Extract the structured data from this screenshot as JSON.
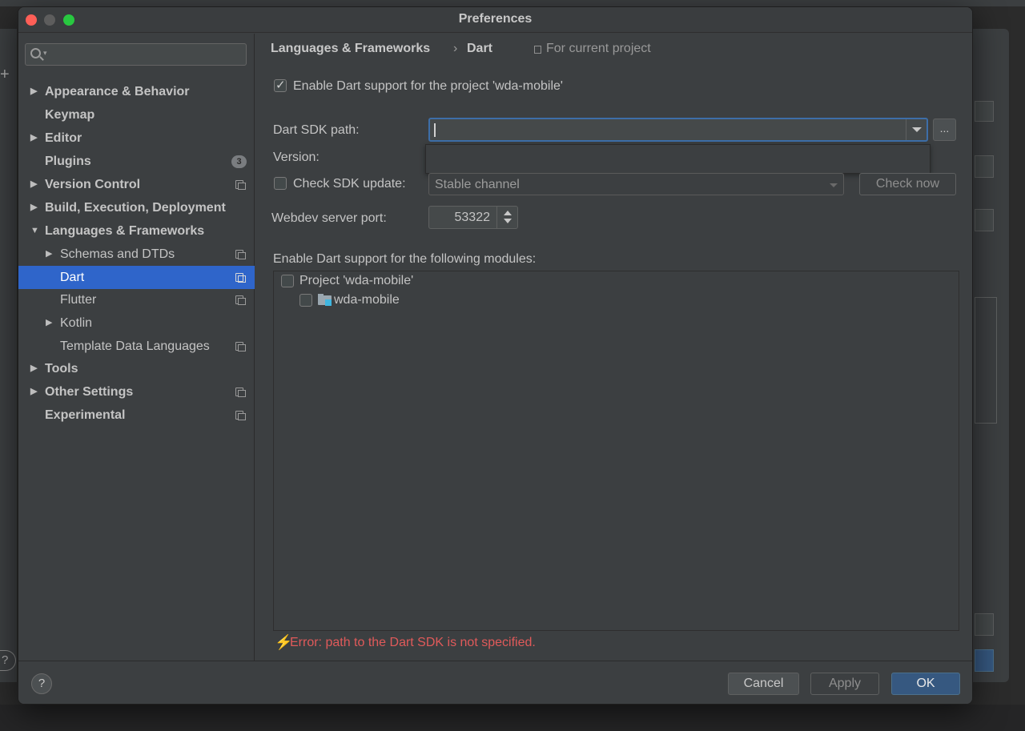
{
  "window": {
    "title": "Preferences"
  },
  "search": {
    "placeholder": ""
  },
  "sidebar": {
    "items": [
      {
        "label": "Appearance & Behavior",
        "arrow": "▶"
      },
      {
        "label": "Keymap"
      },
      {
        "label": "Editor",
        "arrow": "▶"
      },
      {
        "label": "Plugins",
        "badge": "3"
      },
      {
        "label": "Version Control",
        "arrow": "▶"
      },
      {
        "label": "Build, Execution, Deployment",
        "arrow": "▶"
      },
      {
        "label": "Languages & Frameworks",
        "arrow": "▼"
      },
      {
        "label": "Schemas and DTDs",
        "arrow": "▶"
      },
      {
        "label": "Dart"
      },
      {
        "label": "Flutter"
      },
      {
        "label": "Kotlin",
        "arrow": "▶"
      },
      {
        "label": "Template Data Languages"
      },
      {
        "label": "Tools",
        "arrow": "▶"
      },
      {
        "label": "Other Settings",
        "arrow": "▶"
      },
      {
        "label": "Experimental"
      }
    ]
  },
  "breadcrumb": {
    "parent": "Languages & Frameworks",
    "separator": "›",
    "current": "Dart",
    "scope": "For current project"
  },
  "dart": {
    "enable_label": "Enable Dart support for the project 'wda-mobile'",
    "enable_checked": true,
    "sdk_path_label": "Dart SDK path:",
    "sdk_path_value": "",
    "browse_label": "...",
    "version_label": "Version:",
    "check_update_label": "Check SDK update:",
    "check_update_checked": false,
    "channel_value": "Stable channel",
    "check_now_label": "Check now",
    "webdev_label": "Webdev server port:",
    "webdev_port": "53322",
    "modules_label": "Enable Dart support for the following modules:",
    "modules": [
      {
        "label": "Project 'wda-mobile'",
        "checked": false
      },
      {
        "label": "wda-mobile",
        "checked": false
      }
    ],
    "error": "Error: path to the Dart SDK is not specified."
  },
  "footer": {
    "help": "?",
    "cancel": "Cancel",
    "apply": "Apply",
    "ok": "OK"
  },
  "colors": {
    "selection": "#2f65ca",
    "error": "#e05a5a",
    "primary_button": "#365880",
    "focus_border": "#3d6ea8"
  }
}
